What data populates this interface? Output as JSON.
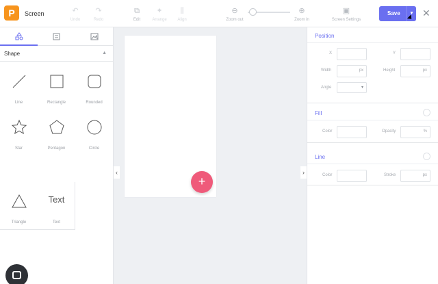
{
  "app": {
    "logo_letter": "P",
    "title": "Screen"
  },
  "toolbar": {
    "undo": "Undo",
    "redo": "Redo",
    "edit": "Edit",
    "arrange": "Arrange",
    "align": "Align",
    "zoom_out": "Zoom out",
    "zoom_in": "Zoom in",
    "screen_settings": "Screen Settings",
    "save": "Save"
  },
  "left_panel": {
    "section_title": "Shape",
    "shapes": [
      {
        "label": "Line",
        "icon": "line-icon"
      },
      {
        "label": "Rectangle",
        "icon": "rectangle-icon"
      },
      {
        "label": "Rounded",
        "icon": "rounded-rectangle-icon"
      },
      {
        "label": "Star",
        "icon": "star-icon"
      },
      {
        "label": "Pentagon",
        "icon": "pentagon-icon"
      },
      {
        "label": "Circle",
        "icon": "circle-icon"
      },
      {
        "label": "Triangle",
        "icon": "triangle-icon"
      },
      {
        "label": "Text",
        "icon": "text-icon",
        "preview": "Text"
      }
    ]
  },
  "right_panel": {
    "position": {
      "title": "Position",
      "x_label": "X",
      "y_label": "Y",
      "width_label": "Width",
      "height_label": "Height",
      "angle_label": "Angle",
      "unit": "px"
    },
    "fill": {
      "title": "Fill",
      "color_label": "Color",
      "opacity_label": "Opacity",
      "opacity_unit": "%"
    },
    "line": {
      "title": "Line",
      "color_label": "Color",
      "stroke_label": "Stroke",
      "stroke_unit": "px"
    }
  },
  "colors": {
    "accent": "#6a6ff0",
    "logo": "#f7941d",
    "fab": "#ef5a7a"
  }
}
